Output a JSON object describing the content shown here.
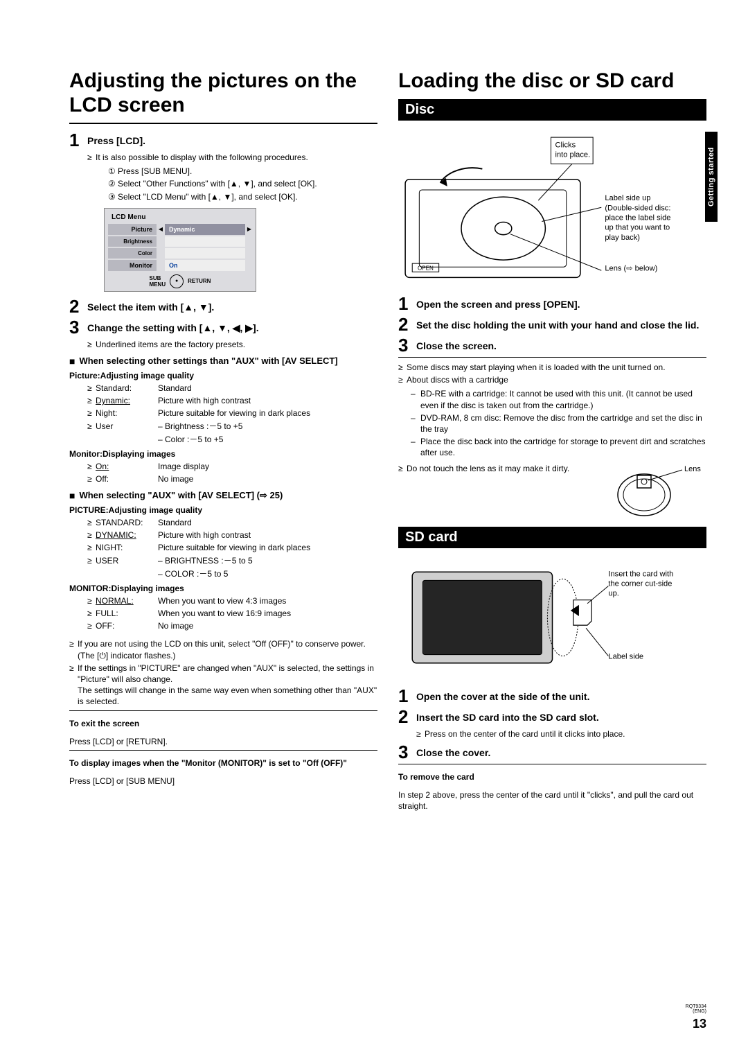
{
  "sideTab": "Getting started",
  "pageNumber": "13",
  "footerCode1": "RQT9334",
  "footerCode2": "(ENG)",
  "left": {
    "title": "Adjusting the pictures on the LCD screen",
    "step1": "Press [LCD].",
    "step1_note": "It is also possible to display with the following procedures.",
    "proc1": "Press [SUB MENU].",
    "proc2": "Select \"Other Functions\" with [▲, ▼], and select [OK].",
    "proc3": "Select \"LCD Menu\" with [▲, ▼], and select [OK].",
    "lcd": {
      "title": "LCD Menu",
      "r1l": "Picture",
      "r1r": "Dynamic",
      "r2l": "Brightness",
      "r3l": "Color",
      "r4l": "Monitor",
      "r4r": "On",
      "foot1": "SUB\nMENU",
      "foot2": "RETURN"
    },
    "step2": "Select the item with [▲, ▼].",
    "step3": "Change the setting with [▲, ▼, ◀, ▶].",
    "step3_note": "Underlined items are the factory presets.",
    "block1_head": "When selecting other settings than \"AUX\" with [AV SELECT]",
    "pic_head": "Picture:Adjusting image quality",
    "pic": [
      {
        "k": "Standard:",
        "v": "Standard"
      },
      {
        "k": "Dynamic:",
        "v": "Picture with high contrast",
        "u": true
      },
      {
        "k": "Night:",
        "v": "Picture suitable for viewing in dark places"
      },
      {
        "k": "User",
        "v": "– Brightness :－5 to +5"
      }
    ],
    "pic_cont": "– Color :－5 to +5",
    "mon_head": "Monitor:Displaying images",
    "mon": [
      {
        "k": "On:",
        "v": "Image display",
        "u": true
      },
      {
        "k": "Off:",
        "v": "No image"
      }
    ],
    "block2_head": "When selecting \"AUX\" with [AV SELECT] (⇨ 25)",
    "pic2_head": "PICTURE:Adjusting image quality",
    "pic2": [
      {
        "k": "STANDARD:",
        "v": "Standard"
      },
      {
        "k": "DYNAMIC:",
        "v": "Picture with high contrast",
        "u": true
      },
      {
        "k": "NIGHT:",
        "v": "Picture suitable for viewing in dark places"
      },
      {
        "k": "USER",
        "v": "– BRIGHTNESS :－5 to 5"
      }
    ],
    "pic2_cont": "– COLOR :－5 to 5",
    "mon2_head": "MONITOR:Displaying images",
    "mon2": [
      {
        "k": "NORMAL:",
        "v": "When you want to view 4:3 images",
        "u": true
      },
      {
        "k": "FULL:",
        "v": "When you want to view 16:9 images"
      },
      {
        "k": "OFF:",
        "v": "No image"
      }
    ],
    "tail1": "If you are not using the LCD on this unit, select \"Off (OFF)\" to conserve power. (The [⏻] indicator flashes.)",
    "tail2": "If the settings in \"PICTURE\" are changed when \"AUX\" is selected, the settings in \"Picture\" will also change.\nThe settings will change in the same way even when something other than \"AUX\" is selected.",
    "exit_head": "To exit the screen",
    "exit_body": "Press [LCD] or [RETURN].",
    "disp_head": "To display images when the \"Monitor (MONITOR)\" is set to \"Off (OFF)\"",
    "disp_body": "Press [LCD] or [SUB MENU]"
  },
  "right": {
    "title": "Loading the disc or SD card",
    "disc_bar": "Disc",
    "diag_disc": {
      "clicks": "Clicks into place.",
      "label": "Label side up (Double-sided disc: place the label side up that you want to play back)",
      "lens": "Lens (⇨ below)",
      "open": "OPEN"
    },
    "d_step1": "Open the screen and press [OPEN].",
    "d_step2": "Set the disc holding the unit with your hand and close the lid.",
    "d_step3": "Close the screen.",
    "d_notes": [
      "Some discs may start playing when it is loaded with the unit turned on.",
      "About discs with a cartridge"
    ],
    "d_dash": [
      "BD-RE with a cartridge: It cannot be used with this unit. (It cannot be used even if the disc is taken out from the cartridge.)",
      "DVD-RAM, 8 cm disc: Remove the disc from the cartridge and set the disc in the tray",
      "Place the disc back into the cartridge for storage to prevent dirt and scratches after use."
    ],
    "lens_note": "Do not touch the lens as it may make it dirty.",
    "lens_label": "Lens",
    "sd_bar": "SD card",
    "diag_sd": {
      "insert": "Insert the card with the corner cut-side up.",
      "label": "Label side"
    },
    "s_step1": "Open the cover at the side of the unit.",
    "s_step2": "Insert the SD card into the SD card slot.",
    "s_step2_note": "Press on the center of the card until it clicks into place.",
    "s_step3": "Close the cover.",
    "remove_head": "To remove the card",
    "remove_body": "In step 2 above, press the center of the card until it \"clicks\", and pull the card out straight."
  }
}
